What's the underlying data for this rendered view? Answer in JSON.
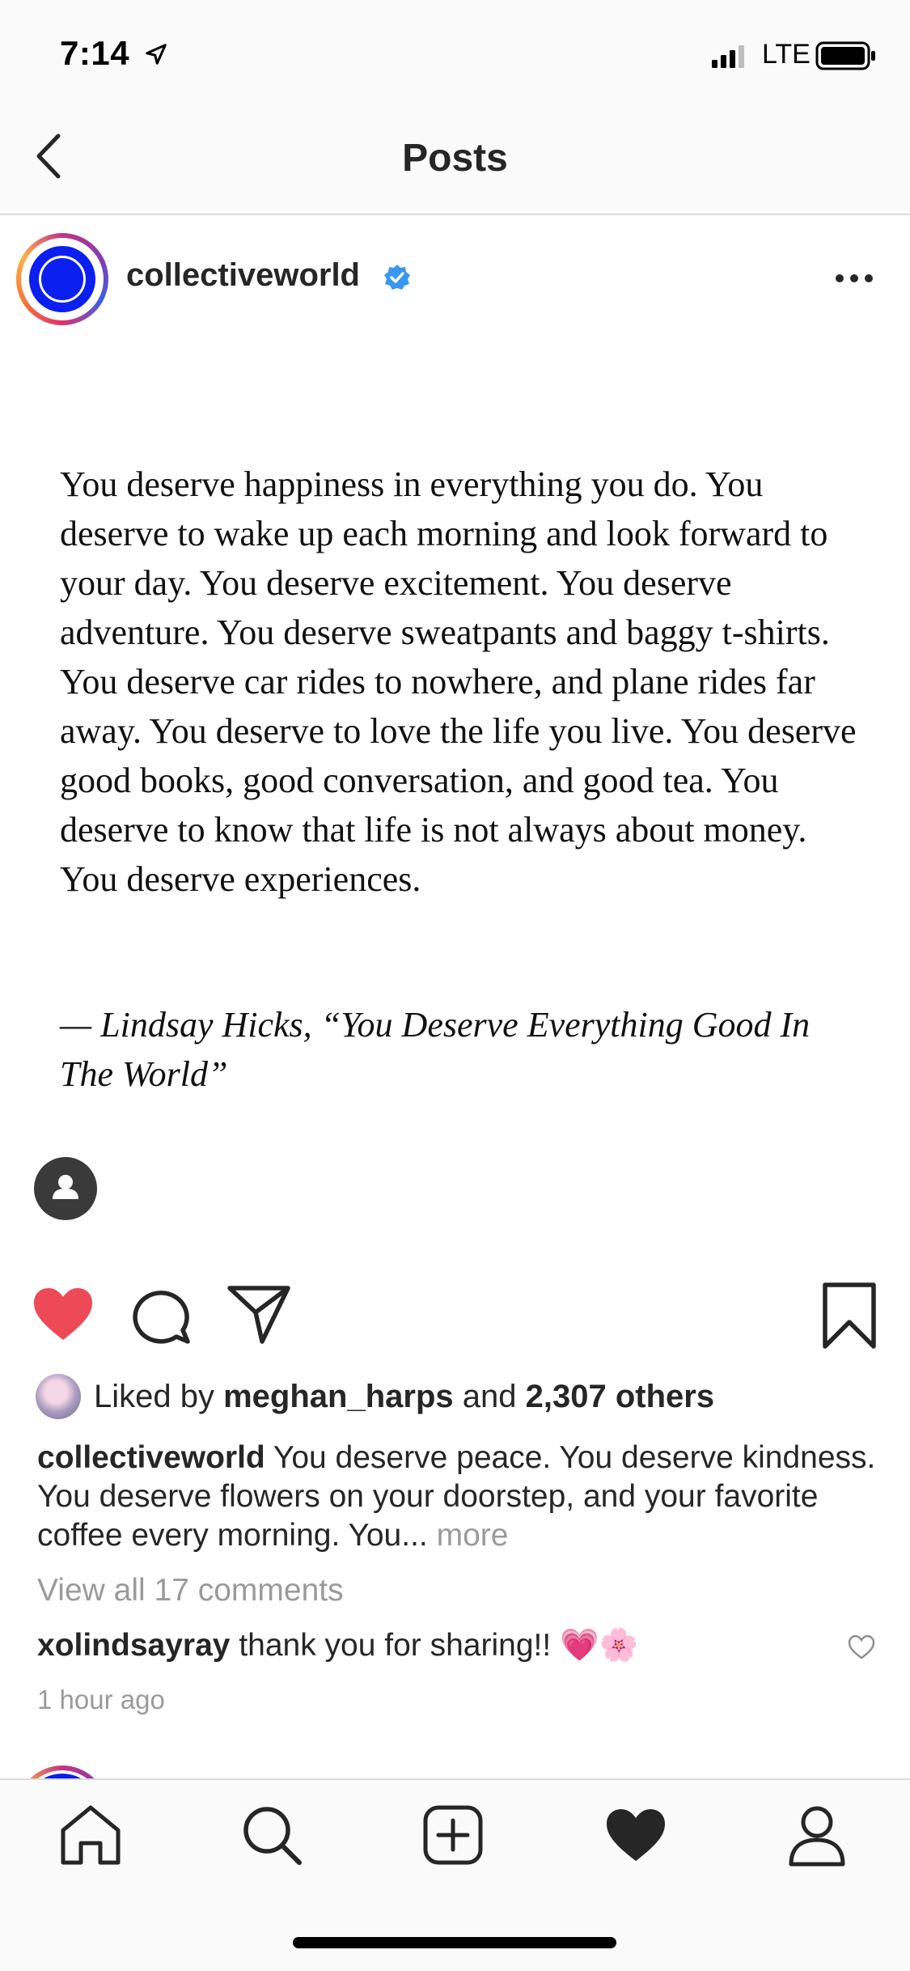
{
  "status_bar": {
    "time": "7:14",
    "network": "LTE"
  },
  "nav": {
    "title": "Posts"
  },
  "post": {
    "username": "collectiveworld",
    "quote": "You deserve happiness in everything you do. You deserve to wake up each morning and look forward to your day. You deserve excitement. You deserve adventure. You deserve sweatpants and baggy t-shirts. You deserve car rides to nowhere, and plane rides far away. You deserve to love the life you live. You deserve good books, good conversation, and good tea. You deserve to know that life is not always about money. You deserve experiences.",
    "attribution": "— Lindsay Hicks, “You Deserve Everything Good In The World”",
    "likes": {
      "prefix": "Liked by",
      "user": "meghan_harps",
      "joiner": "and",
      "others": "2,307 others"
    },
    "caption": {
      "username": "collectiveworld",
      "text": "You deserve peace. You deserve kindness. You deserve flowers on your doorstep, and your favorite coffee every morning. You...",
      "more": "more"
    },
    "view_comments": "View all 17 comments",
    "comment": {
      "username": "xolindsayray",
      "text": "thank you for sharing!! 💗🌸"
    },
    "timestamp": "1 hour ago"
  },
  "colors": {
    "like_red": "#ed4956",
    "verified_blue": "#3897f0",
    "muted_gray": "#9a9a9a",
    "avatar_blue": "#0a1ff0"
  }
}
